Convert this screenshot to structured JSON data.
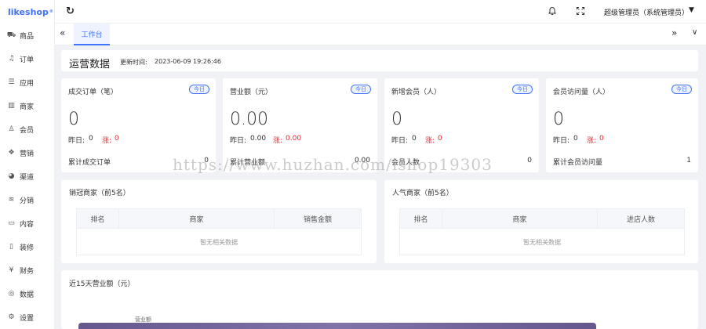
{
  "brand": {
    "name": "likeshop",
    "mark": "®"
  },
  "sidebar": {
    "items": [
      {
        "icon": "cart-icon",
        "label": "商品",
        "glyph": "⛟"
      },
      {
        "icon": "bell-icon",
        "label": "订单",
        "glyph": "♫"
      },
      {
        "icon": "list-icon",
        "label": "应用",
        "glyph": "☰"
      },
      {
        "icon": "store-icon",
        "label": "商家",
        "glyph": "▥"
      },
      {
        "icon": "user-icon",
        "label": "会员",
        "glyph": "♙"
      },
      {
        "icon": "gift-icon",
        "label": "营销",
        "glyph": "❖"
      },
      {
        "icon": "channel-icon",
        "label": "渠道",
        "glyph": "◕"
      },
      {
        "icon": "layers-icon",
        "label": "分销",
        "glyph": "≋"
      },
      {
        "icon": "book-icon",
        "label": "内容",
        "glyph": "▭"
      },
      {
        "icon": "phone-icon",
        "label": "装修",
        "glyph": "▯"
      },
      {
        "icon": "yen-icon",
        "label": "财务",
        "glyph": "¥"
      },
      {
        "icon": "data-icon",
        "label": "数据",
        "glyph": "◎"
      },
      {
        "icon": "settings-icon",
        "label": "设置",
        "glyph": "⚙"
      }
    ]
  },
  "header": {
    "refresh_glyph": "↻",
    "user_name": "超级管理员（系统管理员）",
    "caret": "▼"
  },
  "tabs": {
    "prev_glyph": "«",
    "active_label": "工作台",
    "next_glyph": "»",
    "more_glyph": "∨"
  },
  "operations": {
    "title": "运营数据",
    "update_label": "更新时间:",
    "update_time": "2023-06-09 19:26:46"
  },
  "stats": [
    {
      "label": "成交订单（笔）",
      "badge": "今日",
      "value": "0",
      "yesterday_label": "昨日:",
      "yesterday": "0",
      "rise_label": "涨:",
      "rise": "0",
      "total_label": "累计成交订单",
      "total": "0"
    },
    {
      "label": "营业额（元）",
      "badge": "今日",
      "value": "0.00",
      "yesterday_label": "昨日:",
      "yesterday": "0.00",
      "rise_label": "涨:",
      "rise": "0.00",
      "total_label": "累计营业额",
      "total": "0.00"
    },
    {
      "label": "新增会员（人）",
      "badge": "今日",
      "value": "0",
      "yesterday_label": "昨日:",
      "yesterday": "0",
      "rise_label": "涨:",
      "rise": "0",
      "total_label": "会员人数",
      "total": "0"
    },
    {
      "label": "会员访问量（人）",
      "badge": "今日",
      "value": "0",
      "yesterday_label": "昨日:",
      "yesterday": "0",
      "rise_label": "涨:",
      "rise": "0",
      "total_label": "累计会员访问量",
      "total": "1"
    }
  ],
  "rankings": [
    {
      "title": "销冠商家（前5名）",
      "columns": [
        "排名",
        "商家",
        "销售金额"
      ],
      "empty": "暂无相关数据"
    },
    {
      "title": "人气商家（前5名）",
      "columns": [
        "排名",
        "商家",
        "进店人数"
      ],
      "empty": "暂无相关数据"
    }
  ],
  "revenue_chart": {
    "title": "近15天营业额（元）",
    "legend": "营业额"
  },
  "watermark": "https://www.huzhan.com/ishop19303",
  "colors": {
    "accent": "#4073fa",
    "rise": "#f5222d",
    "background": "#f0f2f5"
  }
}
